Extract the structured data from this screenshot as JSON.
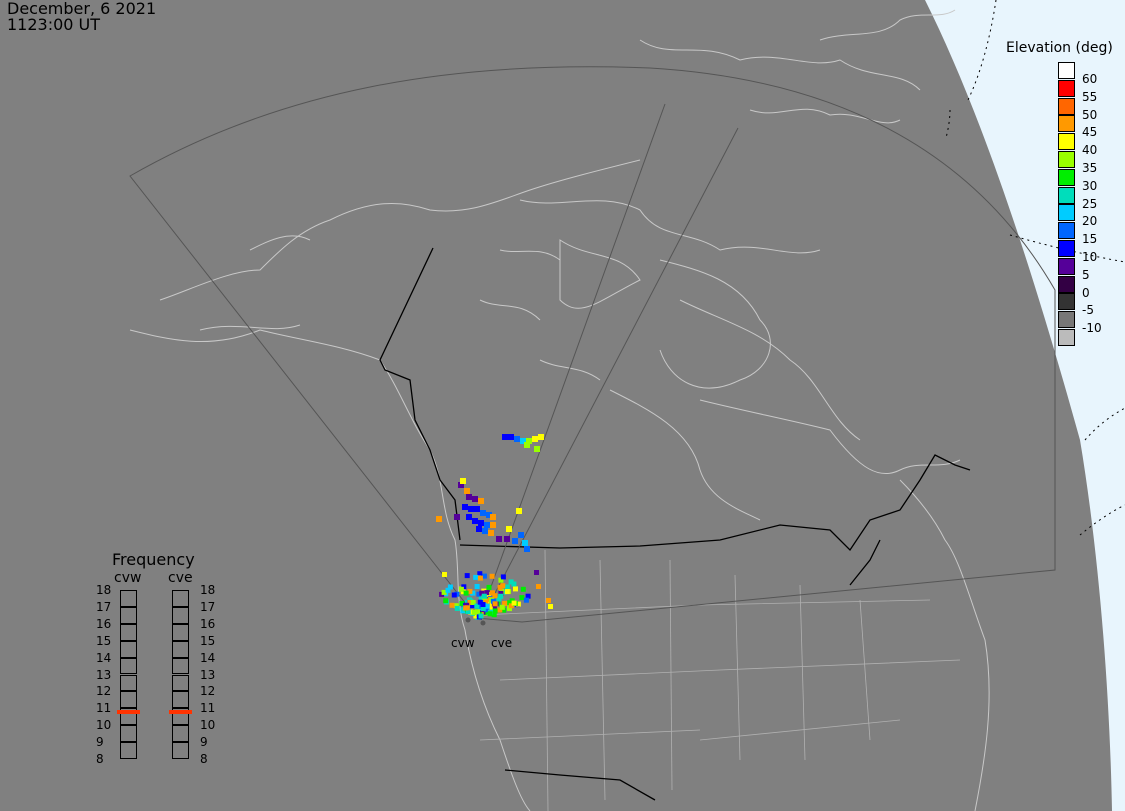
{
  "header": {
    "date": "December, 6 2021",
    "time": "1123:00 UT"
  },
  "elevation_legend": {
    "title": "Elevation (deg)",
    "labels": [
      "60",
      "55",
      "50",
      "45",
      "40",
      "35",
      "30",
      "25",
      "20",
      "15",
      "10",
      "5",
      "0",
      "-5",
      "-10"
    ],
    "colors": [
      "#ffffff",
      "#ff0000",
      "#ff6600",
      "#ff9900",
      "#ffff00",
      "#99ff00",
      "#00ee00",
      "#00ddbb",
      "#00ccff",
      "#0066ff",
      "#0000ff",
      "#550099",
      "#330044",
      "#333333",
      "#777777",
      "#bbbbbb"
    ]
  },
  "frequency_panel": {
    "title": "Frequency",
    "radars": [
      "cvw",
      "cve"
    ],
    "labels": [
      "18",
      "17",
      "16",
      "15",
      "14",
      "13",
      "12",
      "11",
      "10",
      "9",
      "8"
    ],
    "selected": {
      "cvw": 10.8,
      "cve": 10.8
    },
    "marker_color": "#ff3300"
  },
  "sites": {
    "west": "cvw",
    "east": "cve"
  },
  "colors": {
    "background": "#808080",
    "ocean_edge": "#e8f5fd",
    "coastline": "#d0d0d0",
    "border": "#000000",
    "fov": "#555555"
  }
}
